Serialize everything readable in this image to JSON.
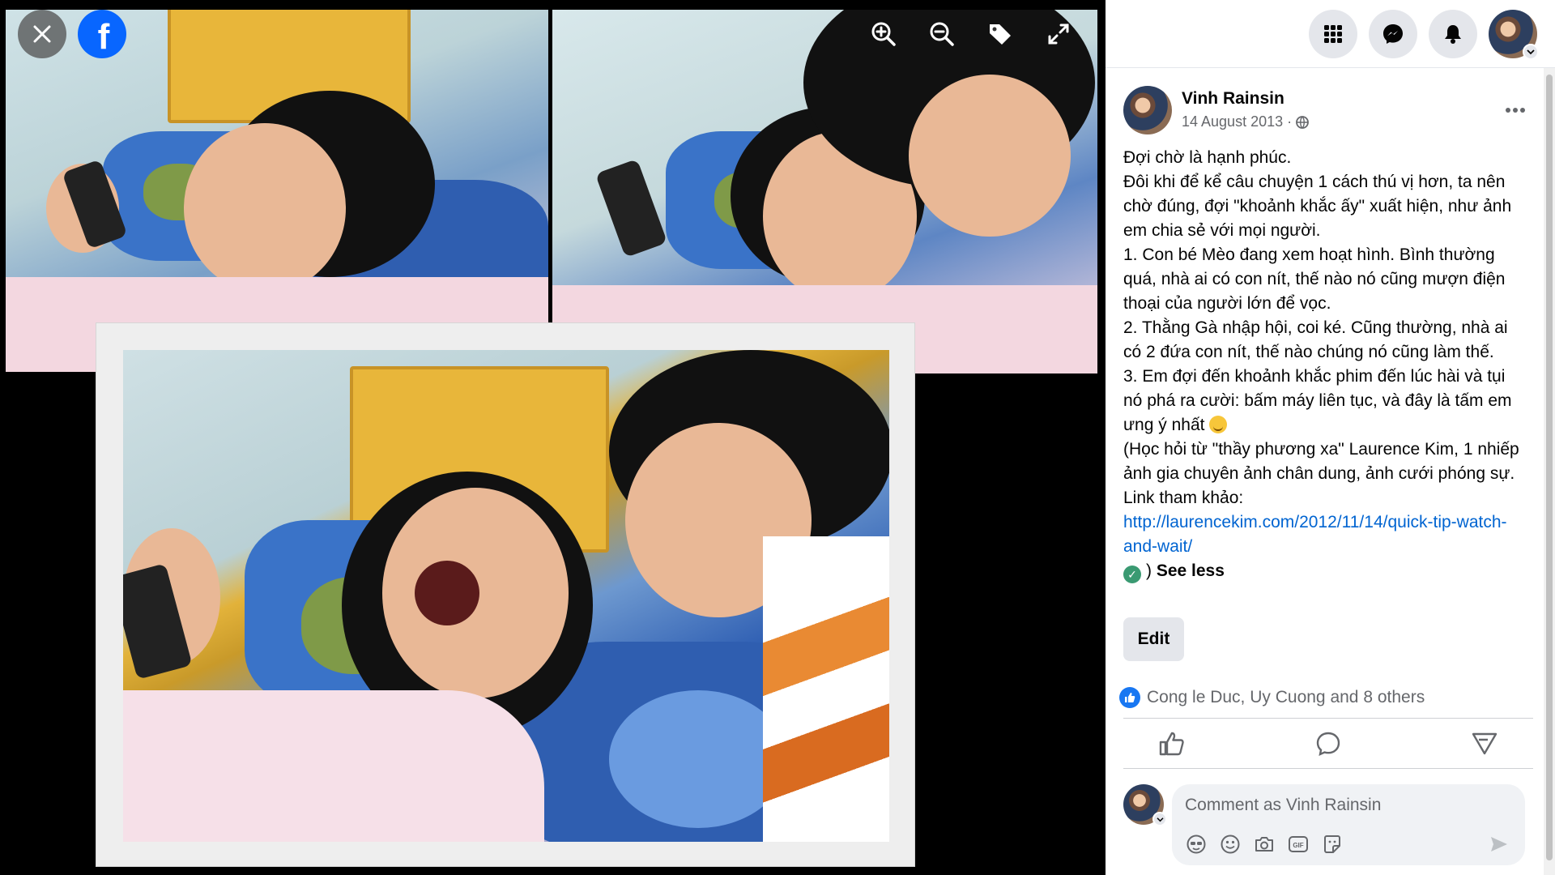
{
  "viewer": {
    "close_icon": "close-icon",
    "logo_letter": "f",
    "tools": [
      "zoom-in-icon",
      "zoom-out-icon",
      "tag-icon",
      "fullscreen-icon"
    ]
  },
  "topbar": {
    "icons": [
      "menu-grid-icon",
      "messenger-icon",
      "notifications-icon"
    ]
  },
  "post": {
    "author": "Vinh Rainsin",
    "date": "14 August 2013 ·",
    "privacy_icon": "public-globe-icon",
    "paragraphs": [
      "Đợi chờ là hạnh phúc.",
      "Đôi khi để kể câu chuyện 1 cách thú vị hơn, ta nên chờ đúng, đợi \"khoảnh khắc ấy\" xuất hiện, như ảnh em chia sẻ với mọi người.",
      "1. Con bé Mèo đang xem hoạt hình. Bình thường quá, nhà ai có con nít, thế nào nó cũng mượn điện thoại của người lớn để vọc.",
      "2. Thằng Gà nhập hội, coi ké. Cũng thường, nhà ai có 2 đứa con nít, thế nào chúng nó cũng làm thế.",
      "3. Em đợi đến khoảnh khắc phim đến lúc hài và tụi nó phá ra cười: bấm máy liên tục, và đây là tấm em ưng ý nhất",
      "(Học hỏi từ \"thầy phương xa\" Laurence Kim, 1 nhiếp ảnh gia chuyên ảnh chân dung, ảnh cưới phóng sự. Link tham khảo:"
    ],
    "link": "http://laurencekim.com/2012/11/14/quick-tip-watch-and-wait/",
    "closing": ")",
    "see_less": "See less",
    "edit_label": "Edit",
    "reactions_text": "Cong le Duc, Uy Cuong and 8 others",
    "actions": [
      "like-icon",
      "comment-icon",
      "share-icon"
    ],
    "comment_placeholder": "Comment as Vinh Rainsin",
    "comment_tools": [
      "avatar-sticker-icon",
      "emoji-icon",
      "camera-icon",
      "gif-icon",
      "sticker-icon"
    ]
  },
  "colors": {
    "accent": "#0866ff",
    "link": "#0064d1",
    "like": "#1877f2"
  }
}
